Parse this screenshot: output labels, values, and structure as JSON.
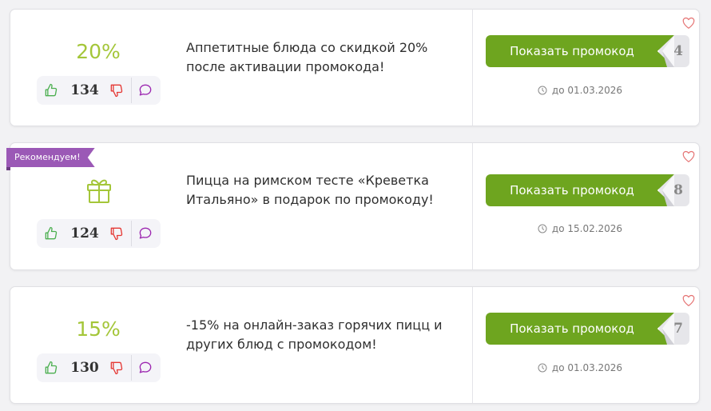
{
  "offers": [
    {
      "discount": "20%",
      "votes": "134",
      "description": "Аппетитные блюда со скидкой 20% после активации промокода!",
      "button_label": "Показать промокод",
      "code_tail": "4",
      "expiry": "до 01.03.2026"
    },
    {
      "badge": "Рекомендуем!",
      "votes": "124",
      "description": "Пицца на римском тесте «Креветка Итальяно» в подарок по промокоду!",
      "button_label": "Показать промокод",
      "code_tail": "8",
      "expiry": "до 15.02.2026"
    },
    {
      "discount": "15%",
      "votes": "130",
      "description": "-15% на онлайн-заказ горячих пицц и других блюд с промокодом!",
      "button_label": "Показать промокод",
      "code_tail": "7",
      "expiry": "до 01.03.2026"
    }
  ],
  "colors": {
    "discount": "#a4c639",
    "button": "#6ea51f",
    "badge": "#9b59b6",
    "thumb_up": "#4caf50",
    "thumb_down": "#e53935",
    "comment": "#9c27b0",
    "heart": "#e57373"
  },
  "icons": [
    "thumbs-up-icon",
    "thumbs-down-icon",
    "comment-icon",
    "clock-icon",
    "heart-icon",
    "gift-icon"
  ]
}
